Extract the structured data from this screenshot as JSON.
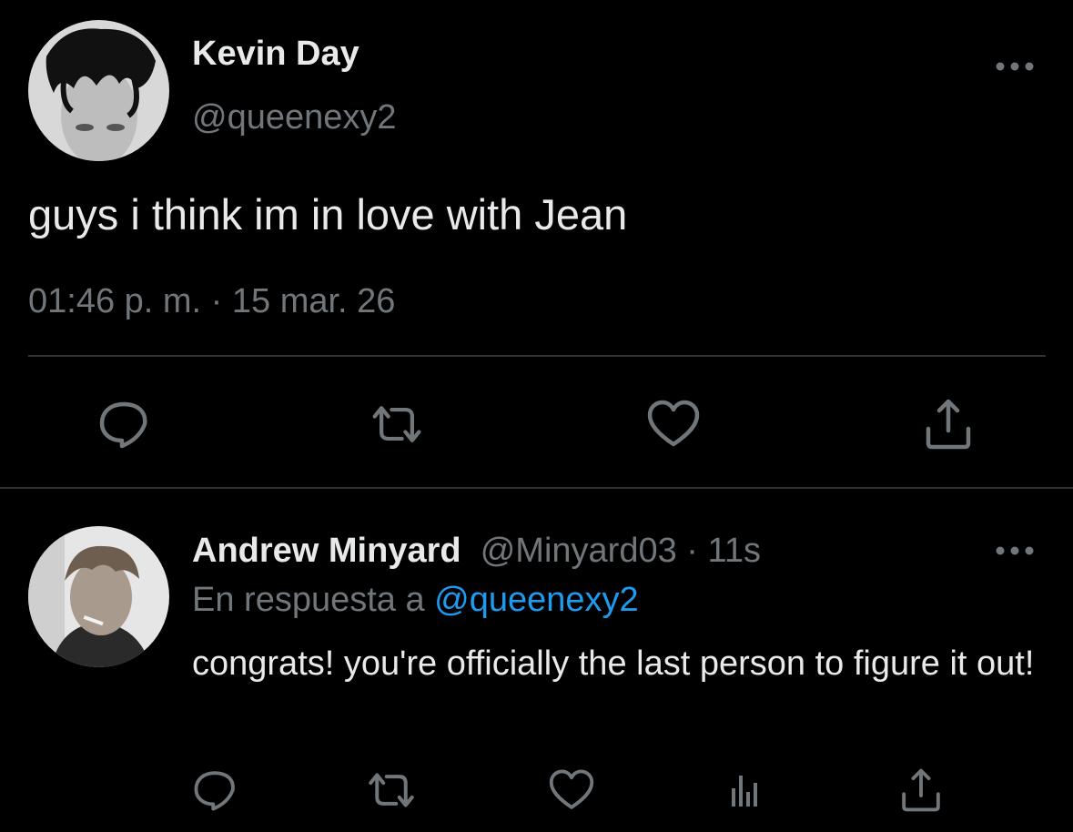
{
  "main_tweet": {
    "author_name": "Kevin Day",
    "author_handle": "@queenexy2",
    "text": "guys i think im in love with Jean",
    "timestamp": "01:46 p. m. · 15 mar. 26",
    "more_icon": "more-horizontal-icon",
    "actions": [
      {
        "name": "reply",
        "icon": "comment-icon"
      },
      {
        "name": "retweet",
        "icon": "retweet-icon"
      },
      {
        "name": "like",
        "icon": "heart-icon"
      },
      {
        "name": "share",
        "icon": "share-icon"
      }
    ]
  },
  "reply_tweet": {
    "author_name": "Andrew Minyard",
    "author_handle": "@Minyard03",
    "separator": " · ",
    "age": "11s",
    "reply_prefix": "En respuesta a ",
    "reply_mention": "@queenexy2",
    "text": "congrats! you're officially the last person to figure it out!",
    "more_icon": "more-horizontal-icon",
    "actions": [
      {
        "name": "reply",
        "icon": "comment-icon"
      },
      {
        "name": "retweet",
        "icon": "retweet-icon"
      },
      {
        "name": "like",
        "icon": "heart-icon"
      },
      {
        "name": "analytics",
        "icon": "analytics-icon"
      },
      {
        "name": "share",
        "icon": "share-icon"
      }
    ]
  },
  "colors": {
    "background": "#000000",
    "text_primary": "#e7e9ea",
    "text_secondary": "#71767b",
    "link": "#1d9bf0",
    "divider": "#2f3336"
  }
}
